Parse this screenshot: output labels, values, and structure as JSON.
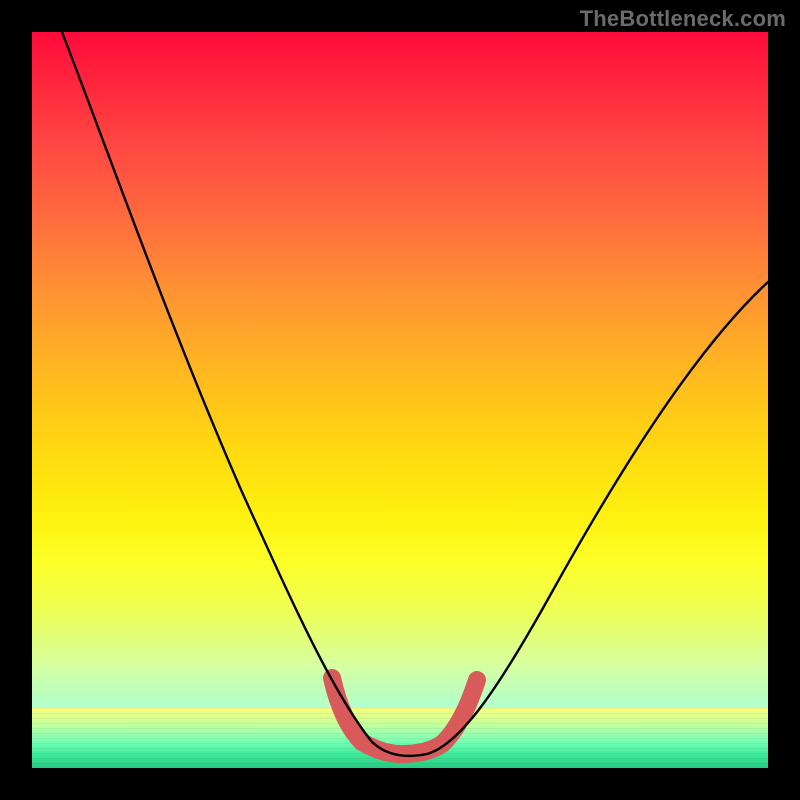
{
  "watermark": "TheBottleneck.com",
  "colors": {
    "frame": "#000000",
    "curve": "#000000",
    "valley_highlight": "#d85a5a",
    "gradient_top": "#ff0a3a",
    "gradient_mid": "#ffd400",
    "gradient_bottom": "#20d880"
  },
  "chart_data": {
    "type": "line",
    "title": "",
    "xlabel": "",
    "ylabel": "",
    "xlim": [
      0,
      100
    ],
    "ylim": [
      0,
      100
    ],
    "notes": "Bottleneck-style V-curve over a red→yellow→green vertical gradient. The black curve descends steeply from the top-left, reaches a flat minimum (highlighted pink) near x≈42-52 at y≈2, then rises to the upper-right. Axis values are not labeled in the image; x and y are normalized 0-100 estimates read from pixel positions.",
    "series": [
      {
        "name": "black-curve",
        "color": "#000000",
        "x": [
          4,
          8,
          12,
          16,
          20,
          24,
          28,
          32,
          36,
          40,
          44,
          48,
          52,
          56,
          60,
          64,
          68,
          72,
          76,
          80,
          84,
          88,
          92,
          96,
          100
        ],
        "y": [
          100,
          90,
          80,
          70,
          60,
          51,
          42,
          33,
          25,
          16,
          7,
          2,
          2,
          6,
          12,
          18,
          24,
          30,
          36,
          42,
          48,
          53,
          58,
          62,
          66
        ]
      },
      {
        "name": "valley-highlight",
        "color": "#d85a5a",
        "x": [
          39,
          41,
          43,
          45,
          47,
          49,
          51,
          53,
          55,
          57
        ],
        "y": [
          11,
          7,
          4,
          2.5,
          2,
          2,
          2.5,
          4,
          7,
          11
        ]
      }
    ],
    "background_gradient_stops": [
      {
        "pos": 0.0,
        "color": "#ff0a3a"
      },
      {
        "pos": 0.25,
        "color": "#ff6a3e"
      },
      {
        "pos": 0.5,
        "color": "#ffc41a"
      },
      {
        "pos": 0.72,
        "color": "#fcff28"
      },
      {
        "pos": 0.92,
        "color": "#b0ffd0"
      },
      {
        "pos": 1.0,
        "color": "#20d880"
      }
    ]
  }
}
